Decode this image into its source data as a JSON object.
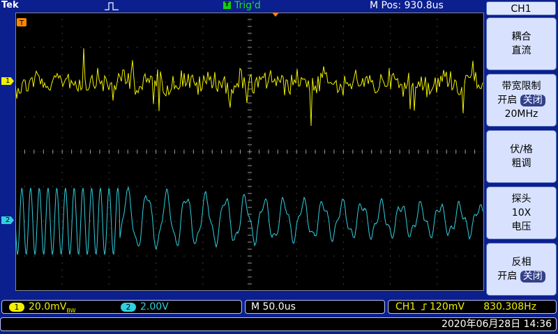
{
  "header": {
    "brand": "Tek",
    "trigger_badge": "T",
    "trigger_status": "Trig'd",
    "mpos_label": "M Pos:",
    "mpos_value": "930.8us"
  },
  "channels": {
    "ch1_marker": "1",
    "ch2_marker": "2",
    "trigger_marker": "T"
  },
  "menu": {
    "title": "CH1",
    "buttons": [
      {
        "line1": "耦合",
        "line2": "直流"
      },
      {
        "line1": "带宽限制",
        "line2a": "开启",
        "line2b": "关闭",
        "line3": "20MHz"
      },
      {
        "line1": "伏/格",
        "line2": "粗调"
      },
      {
        "line1": "探头",
        "line2": "10X",
        "line3": "电压"
      },
      {
        "line1": "反相",
        "line2a": "开启",
        "line2b": "关闭"
      }
    ]
  },
  "status": {
    "ch1_num": "1",
    "ch1_scale": "20.0mV",
    "ch1_suffix": "BW",
    "ch2_num": "2",
    "ch2_scale": "2.00V",
    "timebase": "M 50.0us",
    "trig_source": "CH1",
    "trig_level": "120mV",
    "frequency": "830.308Hz",
    "datetime": "2020年06月28日 14:36"
  },
  "colors": {
    "ch1": "#f0f000",
    "ch2": "#30d0e0",
    "trigger": "#18e018",
    "screen_bg": "#000000",
    "frame": "#0b1f8e"
  }
}
